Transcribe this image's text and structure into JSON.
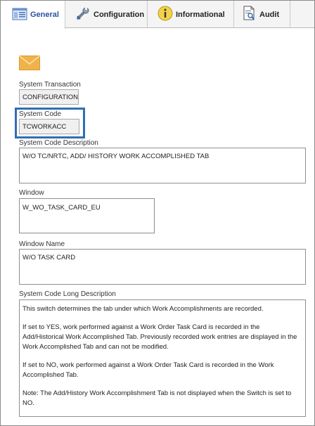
{
  "tabs": [
    {
      "label": "General",
      "icon": "form-icon"
    },
    {
      "label": "Configuration",
      "icon": "wrench-icon"
    },
    {
      "label": "Informational",
      "icon": "info-icon"
    },
    {
      "label": "Audit",
      "icon": "document-search-icon"
    }
  ],
  "envelope_icon": "envelope-icon",
  "fields": {
    "system_transaction": {
      "label": "System Transaction",
      "value": "CONFIGURATION"
    },
    "system_code": {
      "label": "System Code",
      "value": "TCWORKACC"
    },
    "system_code_description": {
      "label": "System Code Description",
      "value": "W/O TC/NRTC, ADD/ HISTORY WORK ACCOMPLISHED TAB"
    },
    "window": {
      "label": "Window",
      "value": "W_WO_TASK_CARD_EU"
    },
    "window_name": {
      "label": "Window Name",
      "value": "W/O TASK CARD"
    },
    "long_description": {
      "label": "System Code Long Description",
      "paragraphs": [
        "This switch determines the tab under which Work Accomplishments are recorded.",
        "If set to YES, work performed against a Work Order Task Card  is recorded in the Add/Historical Work Accomplished Tab. Previously recorded work entries are displayed in the Work Accomplished Tab and can not be modified.",
        "If set to NO, work performed against a Work Order Task Card  is recorded in the Work Accomplished Tab.",
        "Note: The Add/History Work Accomplishment Tab is not displayed when the Switch is set to NO."
      ]
    }
  },
  "colors": {
    "highlight": "#2f6fb5",
    "active_tab_text": "#2a52a0",
    "envelope": "#f0b24a"
  }
}
